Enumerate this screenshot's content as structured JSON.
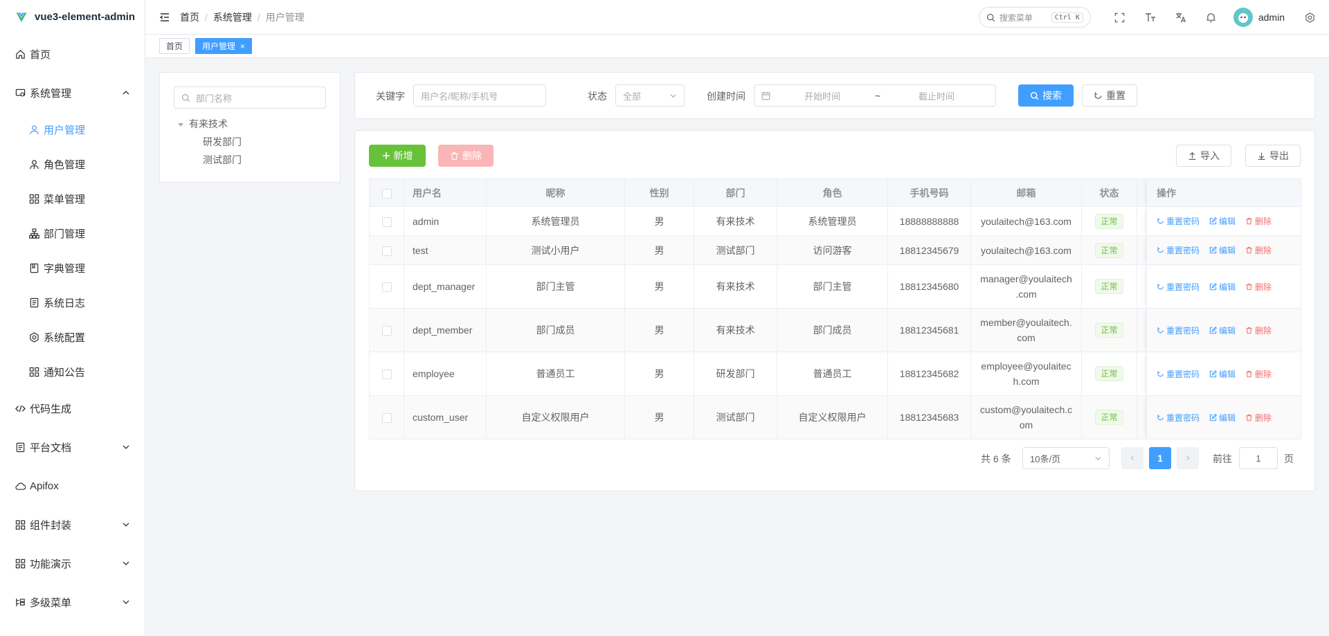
{
  "app": {
    "title": "vue3-element-admin"
  },
  "sidebar": {
    "items": [
      {
        "label": "首页"
      },
      {
        "label": "系统管理"
      },
      {
        "label": "用户管理"
      },
      {
        "label": "角色管理"
      },
      {
        "label": "菜单管理"
      },
      {
        "label": "部门管理"
      },
      {
        "label": "字典管理"
      },
      {
        "label": "系统日志"
      },
      {
        "label": "系统配置"
      },
      {
        "label": "通知公告"
      },
      {
        "label": "代码生成"
      },
      {
        "label": "平台文档"
      },
      {
        "label": "Apifox"
      },
      {
        "label": "组件封装"
      },
      {
        "label": "功能演示"
      },
      {
        "label": "多级菜单"
      }
    ]
  },
  "breadcrumb": {
    "home": "首页",
    "parent": "系统管理",
    "current": "用户管理"
  },
  "navbar": {
    "search_placeholder": "搜索菜单",
    "search_shortcut": "Ctrl K",
    "username": "admin"
  },
  "tags": {
    "home": "首页",
    "current": "用户管理",
    "close": "×"
  },
  "dept_tree": {
    "search_placeholder": "部门名称",
    "root": "有来技术",
    "children": [
      "研发部门",
      "测试部门"
    ]
  },
  "filters": {
    "keyword_label": "关键字",
    "keyword_placeholder": "用户名/昵称/手机号",
    "status_label": "状态",
    "status_value": "全部",
    "date_label": "创建时间",
    "start_placeholder": "开始时间",
    "range_sep": "~",
    "end_placeholder": "截止时间",
    "search_btn": "搜索",
    "reset_btn": "重置"
  },
  "toolbar": {
    "add": "新增",
    "delete": "删除",
    "import": "导入",
    "export": "导出"
  },
  "table": {
    "headers": [
      "用户名",
      "昵称",
      "性别",
      "部门",
      "角色",
      "手机号码",
      "邮箱",
      "状态",
      "操作"
    ],
    "ops": {
      "reset_pwd": "重置密码",
      "edit": "编辑",
      "delete": "删除"
    },
    "rows": [
      {
        "username": "admin",
        "nickname": "系统管理员",
        "gender": "男",
        "dept": "有来技术",
        "role": "系统管理员",
        "phone": "18888888888",
        "email1": "youlaitech@163.com",
        "email2": "",
        "status": "正常"
      },
      {
        "username": "test",
        "nickname": "测试小用户",
        "gender": "男",
        "dept": "测试部门",
        "role": "访问游客",
        "phone": "18812345679",
        "email1": "youlaitech@163.com",
        "email2": "",
        "status": "正常"
      },
      {
        "username": "dept_manager",
        "nickname": "部门主管",
        "gender": "男",
        "dept": "有来技术",
        "role": "部门主管",
        "phone": "18812345680",
        "email1": "manager@youlaitech",
        "email2": ".com",
        "status": "正常"
      },
      {
        "username": "dept_member",
        "nickname": "部门成员",
        "gender": "男",
        "dept": "有来技术",
        "role": "部门成员",
        "phone": "18812345681",
        "email1": "member@youlaitech.",
        "email2": "com",
        "status": "正常"
      },
      {
        "username": "employee",
        "nickname": "普通员工",
        "gender": "男",
        "dept": "研发部门",
        "role": "普通员工",
        "phone": "18812345682",
        "email1": "employee@youlaitec",
        "email2": "h.com",
        "status": "正常"
      },
      {
        "username": "custom_user",
        "nickname": "自定义权限用户",
        "gender": "男",
        "dept": "测试部门",
        "role": "自定义权限用户",
        "phone": "18812345683",
        "email1": "custom@youlaitech.c",
        "email2": "om",
        "status": "正常"
      }
    ]
  },
  "pagination": {
    "total": "共 6 条",
    "page_size": "10条/页",
    "current": "1",
    "goto_label": "前往",
    "goto_value": "1",
    "page_suffix": "页"
  },
  "colors": {
    "primary": "#409eff",
    "success": "#67c23a",
    "danger": "#f56c6c"
  }
}
